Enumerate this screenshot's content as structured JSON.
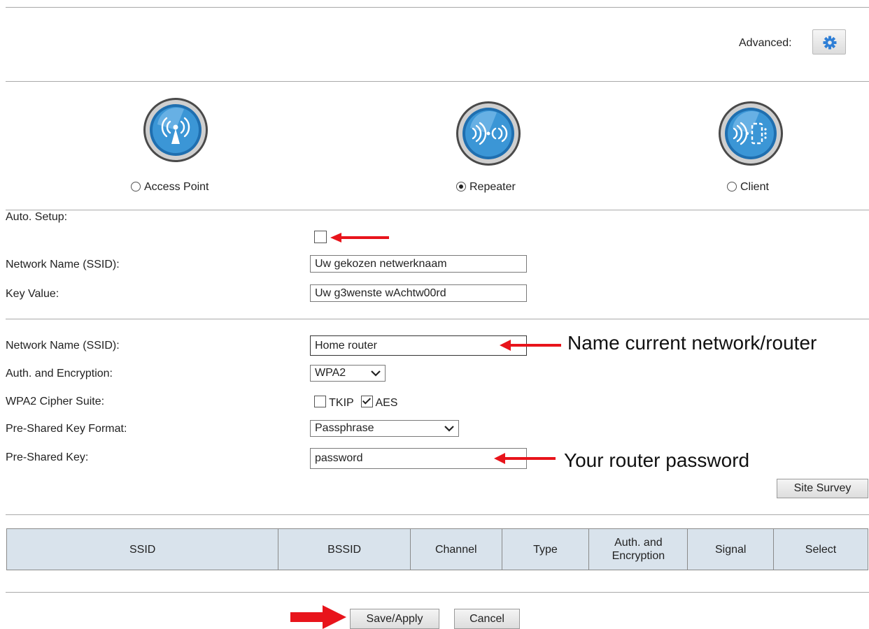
{
  "advanced": {
    "label": "Advanced:",
    "icon": "gear-icon"
  },
  "modes": [
    {
      "label": "Access Point",
      "selected": false,
      "icon": "access-point-icon"
    },
    {
      "label": "Repeater",
      "selected": true,
      "icon": "repeater-icon"
    },
    {
      "label": "Client",
      "selected": false,
      "icon": "client-icon"
    }
  ],
  "auto_setup": {
    "label": "Auto. Setup:",
    "checked": false
  },
  "repeater_ssid": {
    "label": "Network Name (SSID):",
    "value": "Uw gekozen netwerknaam"
  },
  "repeater_key": {
    "label": "Key Value:",
    "value": "Uw g3wenste wAchtw00rd"
  },
  "root_ssid": {
    "label": "Network Name (SSID):",
    "value": "Home router"
  },
  "auth": {
    "label": "Auth. and Encryption:",
    "value": "WPA2"
  },
  "cipher": {
    "label": "WPA2 Cipher Suite:",
    "tkip": {
      "label": "TKIP",
      "checked": false
    },
    "aes": {
      "label": "AES",
      "checked": true
    }
  },
  "psk_format": {
    "label": "Pre-Shared Key Format:",
    "value": "Passphrase"
  },
  "psk": {
    "label": "Pre-Shared Key:",
    "value": "password"
  },
  "site_survey_label": "Site Survey",
  "table": {
    "headers": [
      "SSID",
      "BSSID",
      "Channel",
      "Type",
      "Auth. and Encryption",
      "Signal",
      "Select"
    ]
  },
  "buttons": {
    "save": "Save/Apply",
    "cancel": "Cancel"
  },
  "annotations": {
    "network_note": "Name current network/router",
    "password_note": "Your router password",
    "arrow_color": "#e8141b"
  }
}
